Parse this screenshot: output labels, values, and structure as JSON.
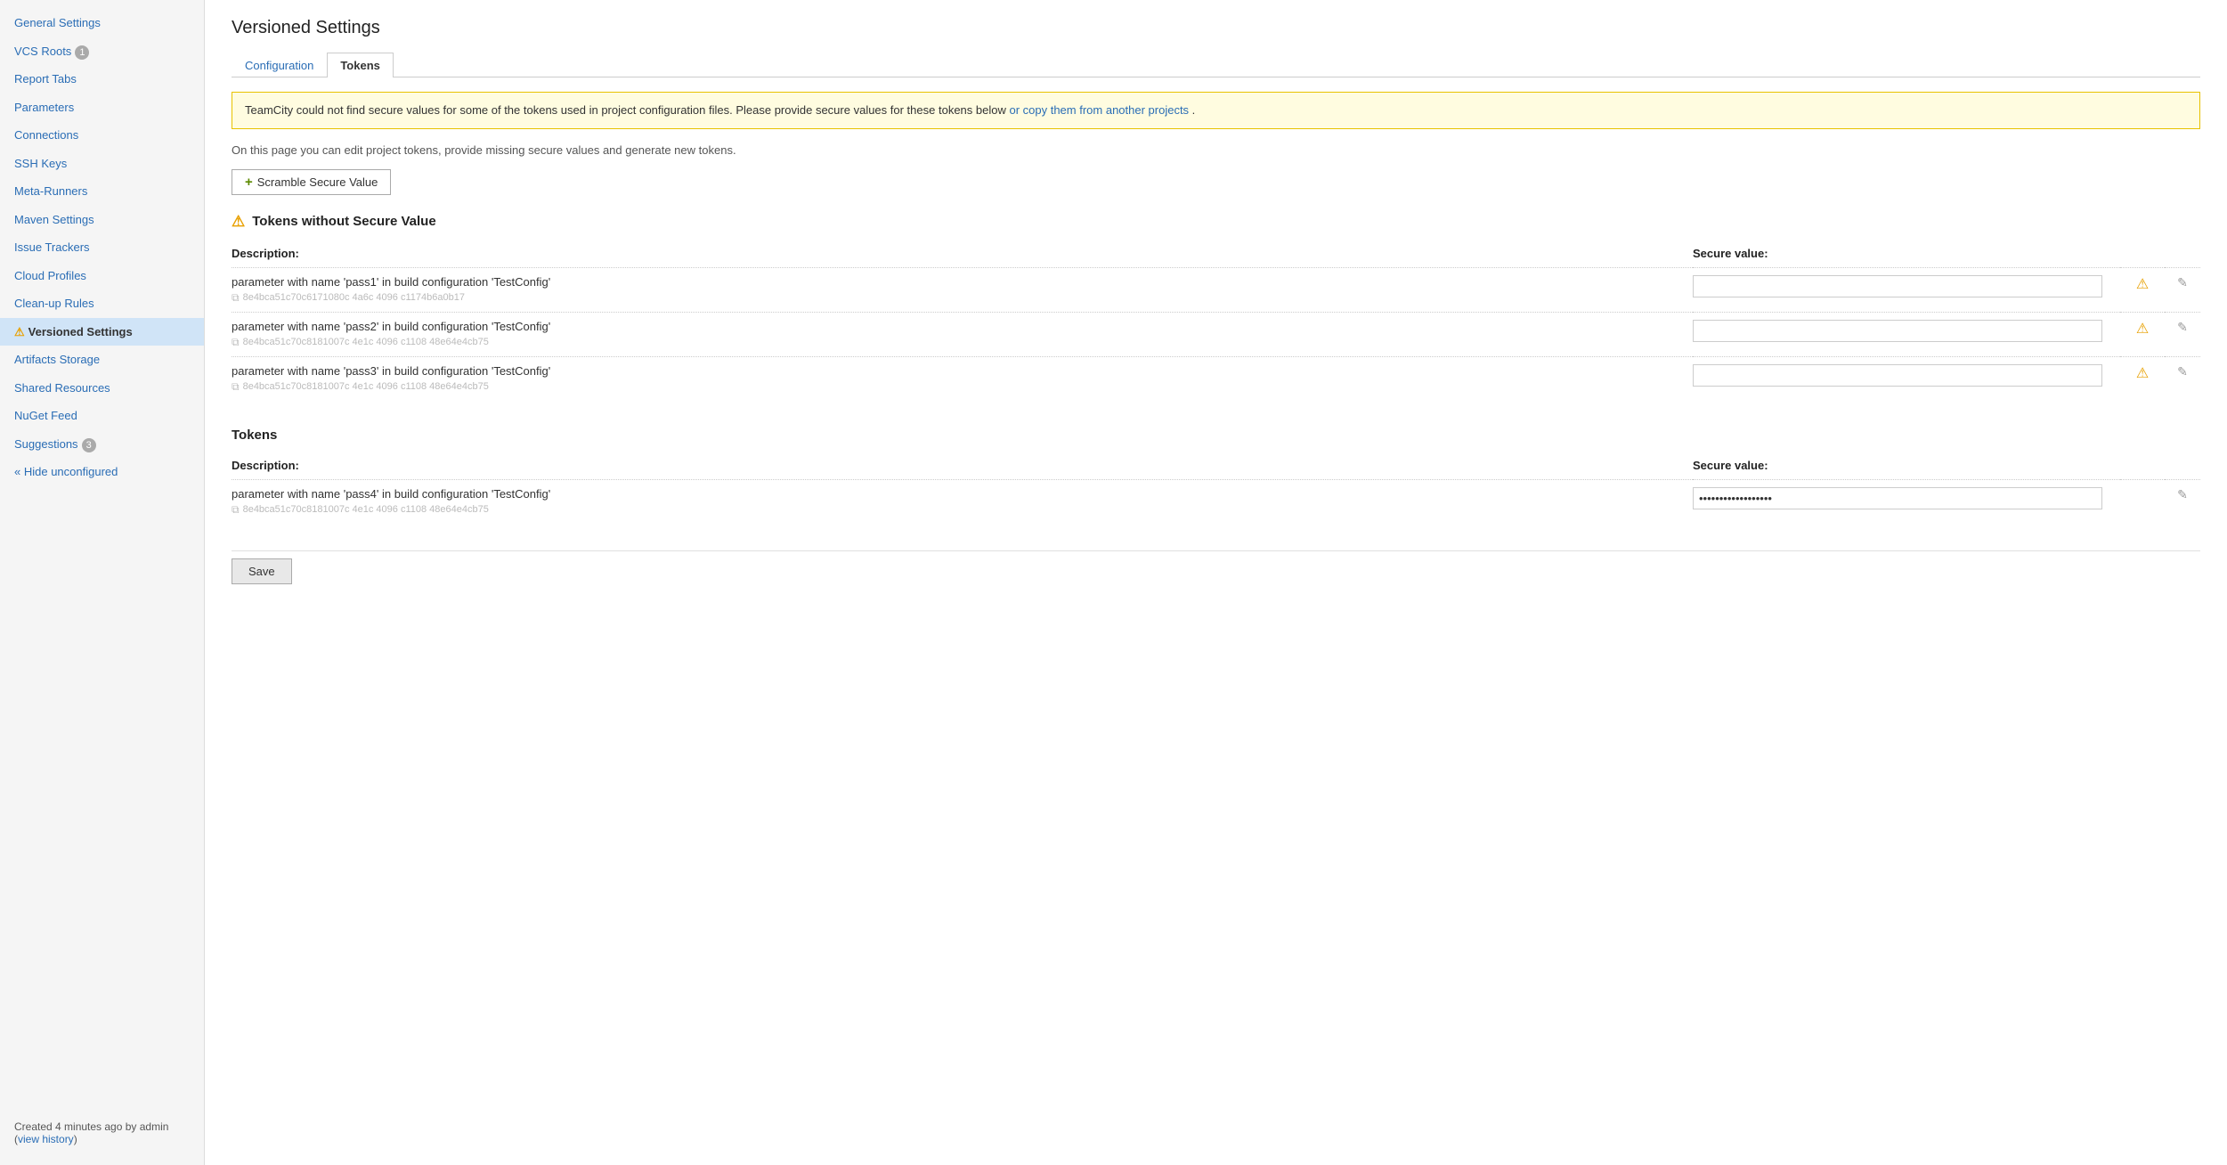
{
  "sidebar": {
    "items": [
      {
        "id": "general-settings",
        "label": "General Settings",
        "badge": null,
        "active": false,
        "warning": false
      },
      {
        "id": "vcs-roots",
        "label": "VCS Roots",
        "badge": "1",
        "active": false,
        "warning": false
      },
      {
        "id": "report-tabs",
        "label": "Report Tabs",
        "badge": null,
        "active": false,
        "warning": false
      },
      {
        "id": "parameters",
        "label": "Parameters",
        "badge": null,
        "active": false,
        "warning": false
      },
      {
        "id": "connections",
        "label": "Connections",
        "badge": null,
        "active": false,
        "warning": false
      },
      {
        "id": "ssh-keys",
        "label": "SSH Keys",
        "badge": null,
        "active": false,
        "warning": false
      },
      {
        "id": "meta-runners",
        "label": "Meta-Runners",
        "badge": null,
        "active": false,
        "warning": false
      },
      {
        "id": "maven-settings",
        "label": "Maven Settings",
        "badge": null,
        "active": false,
        "warning": false
      },
      {
        "id": "issue-trackers",
        "label": "Issue Trackers",
        "badge": null,
        "active": false,
        "warning": false
      },
      {
        "id": "cloud-profiles",
        "label": "Cloud Profiles",
        "badge": null,
        "active": false,
        "warning": false
      },
      {
        "id": "clean-up-rules",
        "label": "Clean-up Rules",
        "badge": null,
        "active": false,
        "warning": false
      },
      {
        "id": "versioned-settings",
        "label": "Versioned Settings",
        "badge": null,
        "active": true,
        "warning": true
      },
      {
        "id": "artifacts-storage",
        "label": "Artifacts Storage",
        "badge": null,
        "active": false,
        "warning": false
      },
      {
        "id": "shared-resources",
        "label": "Shared Resources",
        "badge": null,
        "active": false,
        "warning": false
      },
      {
        "id": "nuget-feed",
        "label": "NuGet Feed",
        "badge": null,
        "active": false,
        "warning": false
      },
      {
        "id": "suggestions",
        "label": "Suggestions",
        "badge": "3",
        "active": false,
        "warning": false
      }
    ],
    "hide_unconfigured": "« Hide unconfigured",
    "footer_created": "Created 4 minutes ago by admin",
    "footer_link": "view history"
  },
  "page": {
    "title": "Versioned Settings",
    "tabs": [
      {
        "id": "configuration",
        "label": "Configuration",
        "active": false
      },
      {
        "id": "tokens",
        "label": "Tokens",
        "active": true
      }
    ],
    "warning_banner": {
      "text_before_link": "TeamCity could not find secure values for some of the tokens used in project configuration files. Please provide secure values for these tokens below ",
      "link_text": "or copy them from another projects",
      "text_after_link": " ."
    },
    "info_text": "On this page you can edit project tokens, provide missing secure values and generate new tokens.",
    "scramble_button": "+ Scramble Secure Value",
    "section_without_secure": {
      "heading": "Tokens without Secure Value",
      "desc_col": "Description:",
      "secure_col": "Secure value:",
      "tokens": [
        {
          "desc": "parameter with name 'pass1' in build configuration 'TestConfig'",
          "hash": "8e4bca51c70c6171080c 4a6c 4096 c1174b6a0b17"
        },
        {
          "desc": "parameter with name 'pass2' in build configuration 'TestConfig'",
          "hash": "8e4bca51c70c8181007c 4e1c 4096 c1108 48e64e4cb75"
        },
        {
          "desc": "parameter with name 'pass3' in build configuration 'TestConfig'",
          "hash": "8e4bca51c70c8181007c 4e1c 4096 c1108 48e64e4cb75"
        }
      ]
    },
    "section_tokens": {
      "heading": "Tokens",
      "desc_col": "Description:",
      "secure_col": "Secure value:",
      "tokens": [
        {
          "desc": "parameter with name 'pass4' in build configuration 'TestConfig'",
          "hash": "8e4bca51c70c8181007c 4e1c 4096 c1108 48e64e4cb75",
          "value": "••••••••••••••••••"
        }
      ]
    },
    "save_button": "Save"
  }
}
